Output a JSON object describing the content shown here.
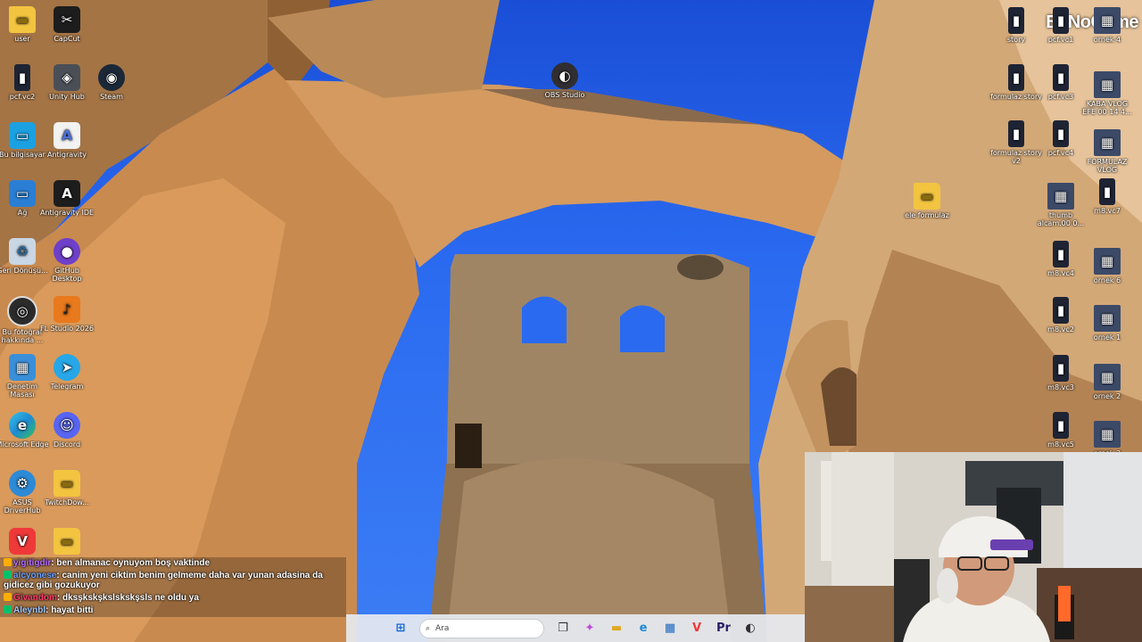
{
  "watermark": "ByNoGame",
  "desktop_icons_left": [
    {
      "label": "user",
      "icon": "folder-icon",
      "glyph": "▬",
      "cls": "folder"
    },
    {
      "label": "CapCut",
      "icon": "capcut-icon",
      "glyph": "✂",
      "cls": "dark"
    },
    {
      "label": "pcf.vc2",
      "icon": "video-file-icon",
      "glyph": "▮",
      "cls": "phone"
    },
    {
      "label": "Unity Hub",
      "icon": "unity-icon",
      "glyph": "◈",
      "cls": "unity"
    },
    {
      "label": "Steam",
      "icon": "steam-icon",
      "glyph": "◉",
      "cls": "steam"
    },
    {
      "label": "Bu bilgisayar",
      "icon": "this-pc-icon",
      "glyph": "▭",
      "cls": "monitor"
    },
    {
      "label": "Antigravity",
      "icon": "antigravity-icon",
      "glyph": "A",
      "cls": "antigravity"
    },
    {
      "label": "Ağ",
      "icon": "network-icon",
      "glyph": "▭",
      "cls": "net"
    },
    {
      "label": "Antigravity IDE",
      "icon": "antigravity-ide-icon",
      "glyph": "A",
      "cls": "dark"
    },
    {
      "label": "Geri Dönüşü...",
      "icon": "recycle-bin-icon",
      "glyph": "♻",
      "cls": "recycle"
    },
    {
      "label": "GitHub Desktop",
      "icon": "github-icon",
      "glyph": "●",
      "cls": "github"
    },
    {
      "label": "Bu fotoğraf hakkında ...",
      "icon": "photo-info-icon",
      "glyph": "◎",
      "cls": "photo"
    },
    {
      "label": "FL Studio 2026",
      "icon": "fl-studio-icon",
      "glyph": "♪",
      "cls": "fl"
    },
    {
      "label": "Denetim Masası",
      "icon": "control-panel-icon",
      "glyph": "▦",
      "cls": "panel"
    },
    {
      "label": "Telegram",
      "icon": "telegram-icon",
      "glyph": "➤",
      "cls": "telegram"
    },
    {
      "label": "Microsoft Edge",
      "icon": "edge-icon",
      "glyph": "e",
      "cls": "edge"
    },
    {
      "label": "Discord",
      "icon": "discord-icon",
      "glyph": "☺",
      "cls": "discord"
    },
    {
      "label": "ASUS DriverHub",
      "icon": "asus-icon",
      "glyph": "⚙",
      "cls": "asus"
    },
    {
      "label": "TwitchDow...",
      "icon": "folder-icon",
      "glyph": "▬",
      "cls": "folder"
    },
    {
      "label": "",
      "icon": "vivaldi-icon",
      "glyph": "V",
      "cls": "vivaldi"
    },
    {
      "label": "",
      "icon": "folder-icon",
      "glyph": "▬",
      "cls": "folder"
    }
  ],
  "desktop_icons_center": [
    {
      "label": "OBS Studio",
      "icon": "obs-icon",
      "glyph": "◐",
      "cls": "obs"
    },
    {
      "label": "ele formulaz",
      "icon": "folder-icon",
      "glyph": "▬",
      "cls": "folder"
    }
  ],
  "desktop_icons_right": [
    {
      "label": "story",
      "icon": "video-file-icon",
      "glyph": "▮",
      "cls": "phone"
    },
    {
      "label": "pcf.vc1",
      "icon": "video-file-icon",
      "glyph": "▮",
      "cls": "phone"
    },
    {
      "label": "ornek 4",
      "icon": "image-file-icon",
      "glyph": "▦",
      "cls": "thumb"
    },
    {
      "label": "formulaz story",
      "icon": "video-file-icon",
      "glyph": "▮",
      "cls": "phone"
    },
    {
      "label": "pcf.vc3",
      "icon": "video-file-icon",
      "glyph": "▮",
      "cls": "phone"
    },
    {
      "label": "KABA VLOG EFE 00 14 4...",
      "icon": "image-file-icon",
      "glyph": "▦",
      "cls": "thumb"
    },
    {
      "label": "formulaz story v2",
      "icon": "video-file-icon",
      "glyph": "▮",
      "cls": "phone"
    },
    {
      "label": "pcf.vc4",
      "icon": "video-file-icon",
      "glyph": "▮",
      "cls": "phone"
    },
    {
      "label": "FORMULAZ VLOG",
      "icon": "image-file-icon",
      "glyph": "▦",
      "cls": "thumb"
    },
    {
      "label": "thumb alcam.00 0...",
      "icon": "image-file-icon",
      "glyph": "▦",
      "cls": "thumb"
    },
    {
      "label": "m8.vc7",
      "icon": "video-file-icon",
      "glyph": "▮",
      "cls": "phone"
    },
    {
      "label": "m8.vc4",
      "icon": "video-file-icon",
      "glyph": "▮",
      "cls": "phone"
    },
    {
      "label": "ornek 6",
      "icon": "image-file-icon",
      "glyph": "▦",
      "cls": "thumb"
    },
    {
      "label": "m8.vc2",
      "icon": "video-file-icon",
      "glyph": "▮",
      "cls": "phone"
    },
    {
      "label": "ornek 1",
      "icon": "image-file-icon",
      "glyph": "▦",
      "cls": "thumb"
    },
    {
      "label": "m8.vc3",
      "icon": "video-file-icon",
      "glyph": "▮",
      "cls": "phone"
    },
    {
      "label": "ornek 2",
      "icon": "image-file-icon",
      "glyph": "▦",
      "cls": "thumb"
    },
    {
      "label": "m8.vc5",
      "icon": "video-file-icon",
      "glyph": "▮",
      "cls": "phone"
    },
    {
      "label": "ornek 3",
      "icon": "image-file-icon",
      "glyph": "▦",
      "cls": "thumb"
    }
  ],
  "chat": [
    {
      "user": "yigitigdir",
      "text": ": ben almanac oynuyom boş vaktinde",
      "cls": ""
    },
    {
      "user": "alcyonese",
      "text": ": canim yeni ciktim benim gelmeme daha var yunan adasina da gidicez gibi gozukuyor",
      "cls": "b"
    },
    {
      "user": "Givandom",
      "text": ": dksşkskşkslskskşsls ne oldu ya",
      "cls": "c"
    },
    {
      "user": "Aleynbl",
      "text": ": hayat bitti",
      "cls": "d"
    }
  ],
  "taskbar": {
    "search_placeholder": "Ara",
    "apps": [
      {
        "name": "start-button",
        "glyph": "⊞",
        "color": "#0a64d6"
      },
      {
        "name": "task-view-button",
        "glyph": "❐",
        "color": "#333"
      },
      {
        "name": "copilot-button",
        "glyph": "✦",
        "color": "#c04ae0"
      },
      {
        "name": "file-explorer-button",
        "glyph": "▬",
        "color": "#e0a820"
      },
      {
        "name": "edge-button",
        "glyph": "e",
        "color": "#1f8ad2"
      },
      {
        "name": "store-button",
        "glyph": "▦",
        "color": "#1766c2"
      },
      {
        "name": "vivaldi-button",
        "glyph": "V",
        "color": "#ef3939"
      },
      {
        "name": "premiere-button",
        "glyph": "Pr",
        "color": "#2a1c66"
      },
      {
        "name": "obs-button",
        "glyph": "◐",
        "color": "#302e31"
      }
    ]
  },
  "colors": {
    "sky": "#2a6af0",
    "stone": "#d7a66a",
    "chat_user_purple": "#b56cff"
  }
}
